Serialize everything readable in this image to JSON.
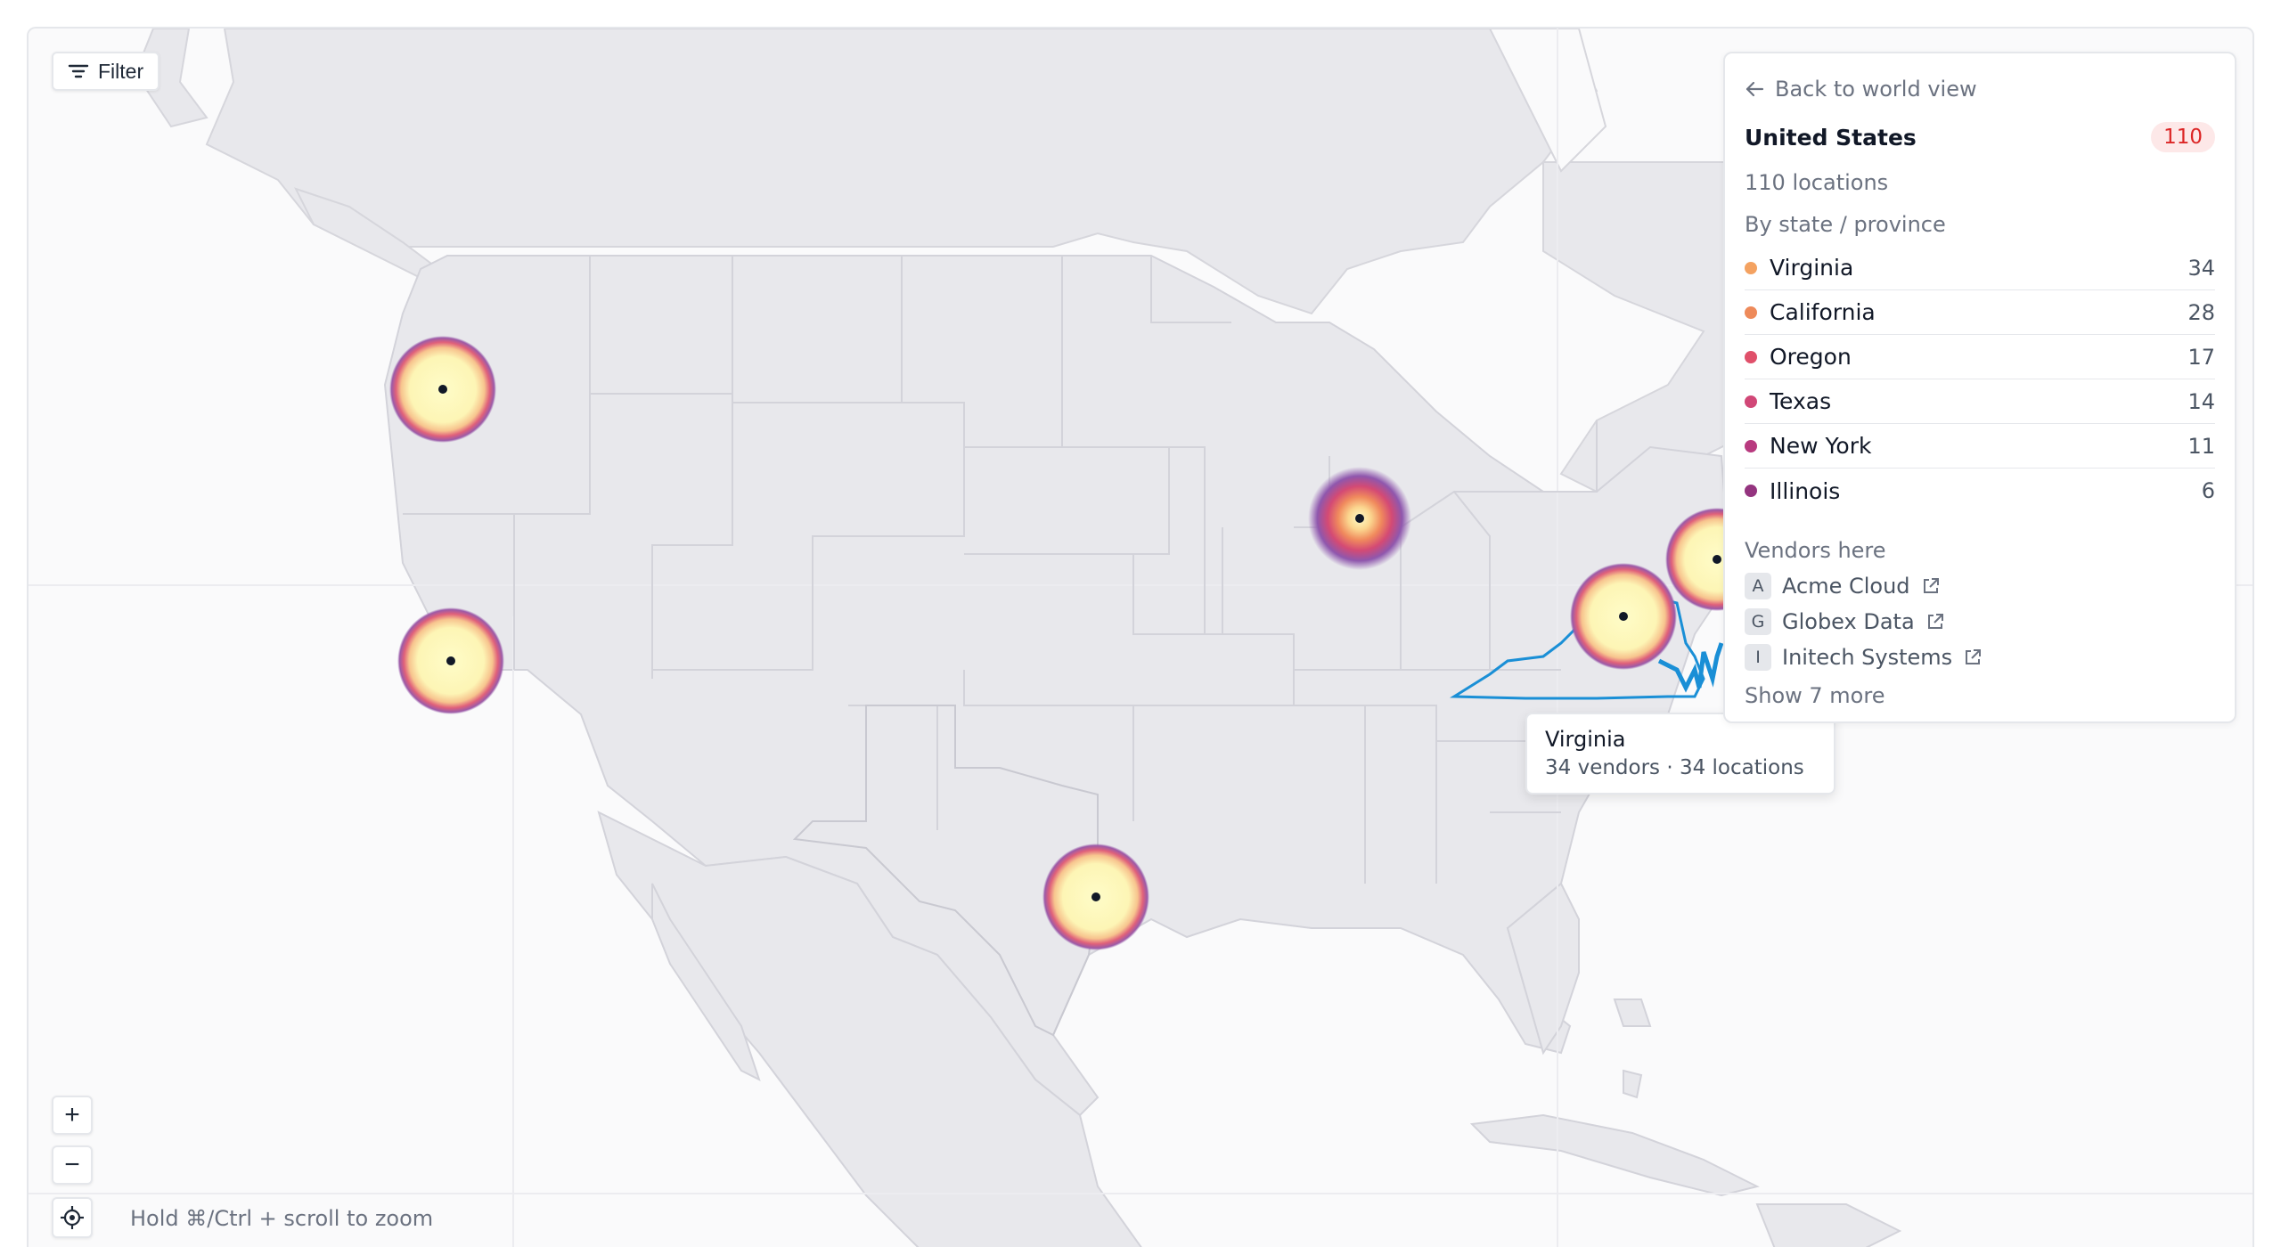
{
  "toolbar": {
    "filter_label": "Filter"
  },
  "controls": {
    "zoom_in": "+",
    "zoom_out": "−",
    "zoom_hint": "Hold ⌘/Ctrl + scroll to zoom"
  },
  "panel": {
    "back_label": "Back to world view",
    "country": "United States",
    "country_badge": "110",
    "locations_label": "110 locations",
    "states_title": "By state / province",
    "states": [
      {
        "name": "Virginia",
        "count": "34",
        "color": "#f4a261"
      },
      {
        "name": "California",
        "count": "28",
        "color": "#ee8a5a"
      },
      {
        "name": "Oregon",
        "count": "17",
        "color": "#e0506a"
      },
      {
        "name": "Texas",
        "count": "14",
        "color": "#d14777"
      },
      {
        "name": "New York",
        "count": "11",
        "color": "#b83a7f"
      },
      {
        "name": "Illinois",
        "count": "6",
        "color": "#94347f"
      }
    ],
    "vendors_title": "Vendors here",
    "vendors": [
      {
        "initial": "A",
        "name": "Acme Cloud"
      },
      {
        "initial": "G",
        "name": "Globex Data"
      },
      {
        "initial": "I",
        "name": "Initech Systems"
      }
    ],
    "show_more": "Show 7 more"
  },
  "tooltip": {
    "title": "Virginia",
    "subtitle": "34 vendors · 34 locations"
  },
  "colors": {
    "land": "#e8e8ec",
    "highlight": "#1a8fd6",
    "badge_text": "#dc2626",
    "badge_bg": "#fde8e8"
  }
}
